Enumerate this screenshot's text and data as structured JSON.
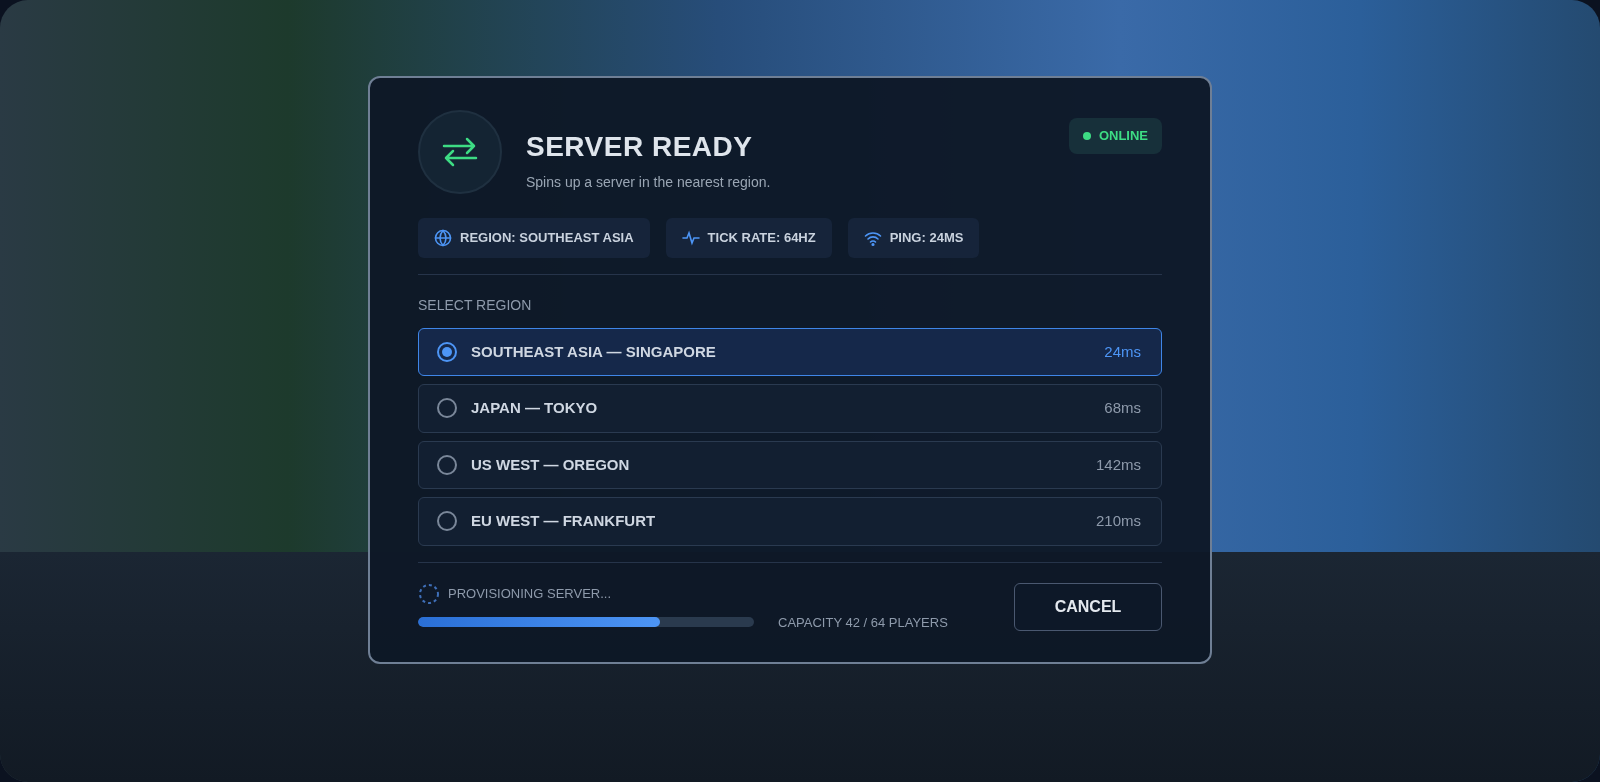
{
  "header": {
    "title": "SERVER READY",
    "subtitle": "Spins up a server in the nearest region.",
    "status": "ONLINE"
  },
  "chips": [
    {
      "kind": "globe",
      "label": "REGION: SOUTHEAST ASIA"
    },
    {
      "kind": "pulse",
      "label": "TICK RATE: 64HZ"
    },
    {
      "kind": "wifi",
      "label": "PING: 24MS"
    }
  ],
  "region_heading": "SELECT REGION",
  "regions": [
    {
      "name": "SOUTHEAST ASIA — SINGAPORE",
      "ping": "24ms",
      "selected": true
    },
    {
      "name": "JAPAN — TOKYO",
      "ping": "68ms",
      "selected": false
    },
    {
      "name": "US WEST — OREGON",
      "ping": "142ms",
      "selected": false
    },
    {
      "name": "EU WEST — FRANKFURT",
      "ping": "210ms",
      "selected": false
    }
  ],
  "progress": {
    "label": "PROVISIONING SERVER...",
    "level": 0.72,
    "capacity": "CAPACITY 42 / 64 PLAYERS"
  },
  "buttons": [
    "CANCEL"
  ]
}
